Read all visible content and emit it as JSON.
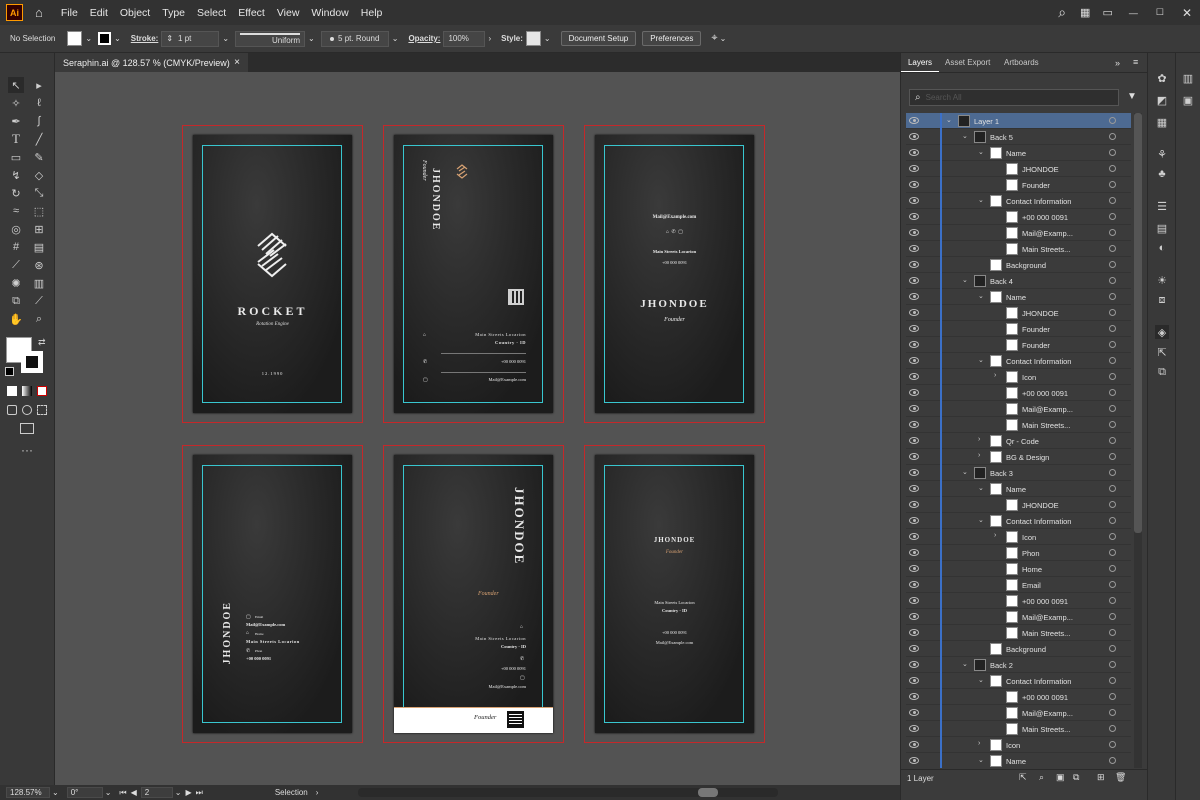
{
  "app": {
    "logo": "Ai",
    "menus": [
      "File",
      "Edit",
      "Object",
      "Type",
      "Select",
      "Effect",
      "View",
      "Window",
      "Help"
    ]
  },
  "control": {
    "selection": "No Selection",
    "stroke_label": "Stroke:",
    "stroke_value": "1 pt",
    "stroke_style": "Uniform",
    "brush": "5 pt. Round",
    "opacity_label": "Opacity:",
    "opacity_value": "100%",
    "style_label": "Style:",
    "document_setup": "Document Setup",
    "preferences": "Preferences"
  },
  "doc_tab": {
    "title": "Seraphin.ai @ 128.57 % (CMYK/Preview)",
    "close": "×"
  },
  "status": {
    "zoom": "128.57%",
    "rotation": "0°",
    "artboard": "2",
    "tool": "Selection"
  },
  "cards": {
    "rocket": "ROCKET",
    "tagline": "Rotation Engine",
    "code": "12.1990",
    "name": "JHONDOE",
    "founder": "Founder",
    "street": "Main Streets Locarion",
    "country": "Country - ID",
    "phone": "+00 000 0091",
    "mail": "Mail@Example.com",
    "label_email": "Email",
    "label_home": "Home",
    "label_phon": "Phon"
  },
  "panel": {
    "tabs": [
      "Layers",
      "Asset Export",
      "Artboards"
    ],
    "search_placeholder": "Search All",
    "footer_count": "1 Layer"
  },
  "layers": [
    {
      "name": "Layer 1",
      "indent": 0,
      "expanded": true,
      "selected": true
    },
    {
      "name": "Back 5",
      "indent": 1,
      "expanded": true
    },
    {
      "name": "Name",
      "indent": 2,
      "expanded": true
    },
    {
      "name": "JHONDOE",
      "indent": 3
    },
    {
      "name": "Founder",
      "indent": 3
    },
    {
      "name": "Contact Information",
      "indent": 2,
      "expanded": true
    },
    {
      "name": "+00 000 0091",
      "indent": 3
    },
    {
      "name": "Mail@Examp...",
      "indent": 3
    },
    {
      "name": "Main Streets...",
      "indent": 3
    },
    {
      "name": "Background",
      "indent": 2
    },
    {
      "name": "Back 4",
      "indent": 1,
      "expanded": true
    },
    {
      "name": "Name",
      "indent": 2,
      "expanded": true
    },
    {
      "name": "JHONDOE",
      "indent": 3
    },
    {
      "name": "Founder",
      "indent": 3
    },
    {
      "name": "Founder",
      "indent": 3
    },
    {
      "name": "Contact Information",
      "indent": 2,
      "expanded": true
    },
    {
      "name": "Icon",
      "indent": 3,
      "collapsed": true
    },
    {
      "name": "+00 000 0091",
      "indent": 3
    },
    {
      "name": "Mail@Examp...",
      "indent": 3
    },
    {
      "name": "Main Streets...",
      "indent": 3
    },
    {
      "name": "Qr - Code",
      "indent": 2,
      "collapsed": true
    },
    {
      "name": "BG & Design",
      "indent": 2,
      "collapsed": true
    },
    {
      "name": "Back 3",
      "indent": 1,
      "expanded": true
    },
    {
      "name": "Name",
      "indent": 2,
      "expanded": true
    },
    {
      "name": "JHONDOE",
      "indent": 3
    },
    {
      "name": "Contact Information",
      "indent": 2,
      "expanded": true
    },
    {
      "name": "Icon",
      "indent": 3,
      "collapsed": true
    },
    {
      "name": "Phon",
      "indent": 3
    },
    {
      "name": "Home",
      "indent": 3
    },
    {
      "name": "Email",
      "indent": 3
    },
    {
      "name": "+00 000 0091",
      "indent": 3
    },
    {
      "name": "Mail@Examp...",
      "indent": 3
    },
    {
      "name": "Main Streets...",
      "indent": 3
    },
    {
      "name": "Background",
      "indent": 2
    },
    {
      "name": "Back 2",
      "indent": 1,
      "expanded": true
    },
    {
      "name": "Contact Information",
      "indent": 2,
      "expanded": true
    },
    {
      "name": "+00 000 0091",
      "indent": 3
    },
    {
      "name": "Mail@Examp...",
      "indent": 3
    },
    {
      "name": "Main Streets...",
      "indent": 3
    },
    {
      "name": "Icon",
      "indent": 2,
      "collapsed": true
    },
    {
      "name": "Name",
      "indent": 2,
      "expanded": true
    }
  ],
  "colors": {
    "accent_guide": "#38c6cf",
    "artboard_border": "#c5282a",
    "selection": "#4d6a92",
    "logo_orange": "#ff9a00",
    "gold": "#d8a273"
  }
}
